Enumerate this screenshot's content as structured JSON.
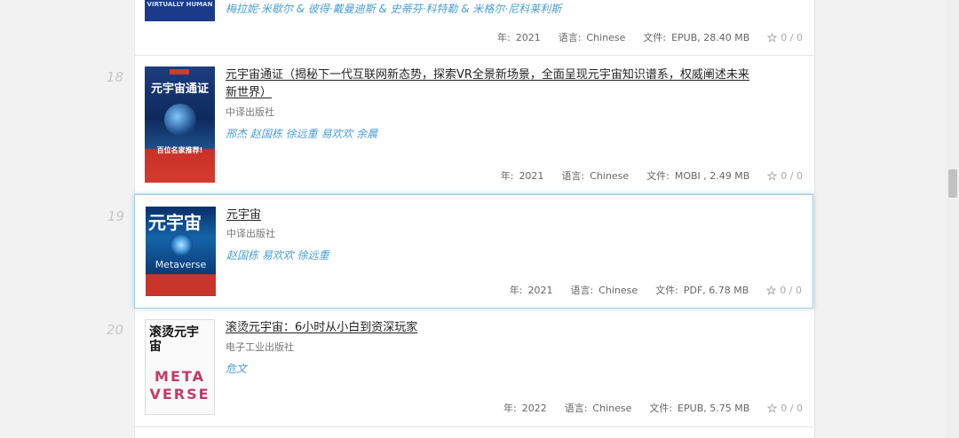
{
  "colors": {
    "accent": "#4a9ed3",
    "active_border": "#9fcfe6"
  },
  "books": [
    {
      "number": "",
      "title": "",
      "publisher": "",
      "authors": "梅拉妮·米歇尔 & 彼得·戴曼迪斯 & 史蒂芬·科特勒 & 米格尔·尼科莱利斯",
      "cover_text": "VIRTUALLY HUMAN",
      "year_label": "年:",
      "year": "2021",
      "lang_label": "语言:",
      "language": "Chinese",
      "file_label": "文件:",
      "file": "EPUB, 28.40 MB",
      "rating": "0 / 0"
    },
    {
      "number": "18",
      "title": "元宇宙通证（揭秘下一代互联网新态势，探索VR全景新场景，全面呈现元宇宙知识谱系，权威阐述未来新世界）",
      "publisher": "中译出版社",
      "authors": "邢杰 赵国栋 徐远重 易欢欢 余晨",
      "cover_text": "元宇宙通证",
      "cover_sub": "百位名家推荐!",
      "year_label": "年:",
      "year": "2021",
      "lang_label": "语言:",
      "language": "Chinese",
      "file_label": "文件:",
      "file": "MOBI , 2.49 MB",
      "rating": "0 / 0"
    },
    {
      "number": "19",
      "title": "元宇宙",
      "publisher": "中译出版社",
      "authors": "赵国栋 易欢欢 徐远重",
      "cover_text": "元宇宙",
      "cover_sub": "Metaverse",
      "year_label": "年:",
      "year": "2021",
      "lang_label": "语言:",
      "language": "Chinese",
      "file_label": "文件:",
      "file": "PDF, 6.78 MB",
      "rating": "0 / 0"
    },
    {
      "number": "20",
      "title": "滚烫元宇宙：6小时从小白到资深玩家",
      "publisher": "电子工业出版社",
      "authors": "危文",
      "cover_text": "滚烫元宇宙",
      "cover_sub": "META VERSE",
      "year_label": "年:",
      "year": "2022",
      "lang_label": "语言:",
      "language": "Chinese",
      "file_label": "文件:",
      "file": "EPUB, 5.75 MB",
      "rating": "0 / 0"
    }
  ]
}
